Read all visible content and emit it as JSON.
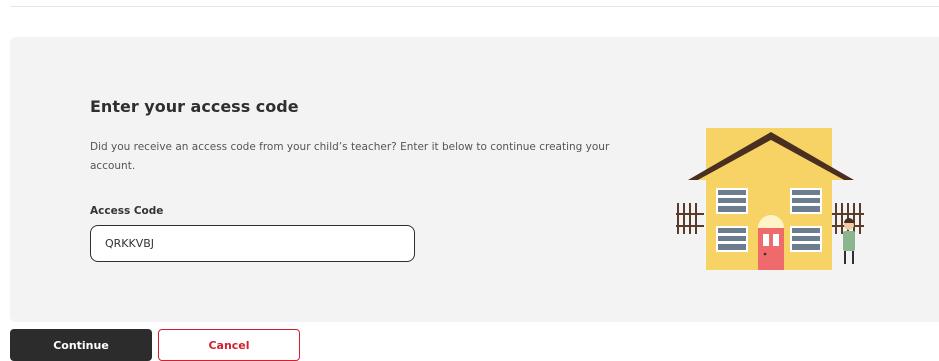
{
  "form": {
    "title": "Enter your access code",
    "description": "Did you receive an access code from your child’s teacher? Enter it below to continue creating your account.",
    "field_label": "Access Code",
    "field_value": "QRKKVBJ"
  },
  "actions": {
    "continue_label": "Continue",
    "cancel_label": "Cancel"
  },
  "illustration": {
    "icon": "house-illustration"
  },
  "colors": {
    "primary_button": "#2c2c2c",
    "cancel_accent": "#d11f2f",
    "panel_background": "#f3f3f3",
    "house_wall": "#f7d264",
    "roof": "#4a2f20",
    "door": "#ef6a6a"
  }
}
